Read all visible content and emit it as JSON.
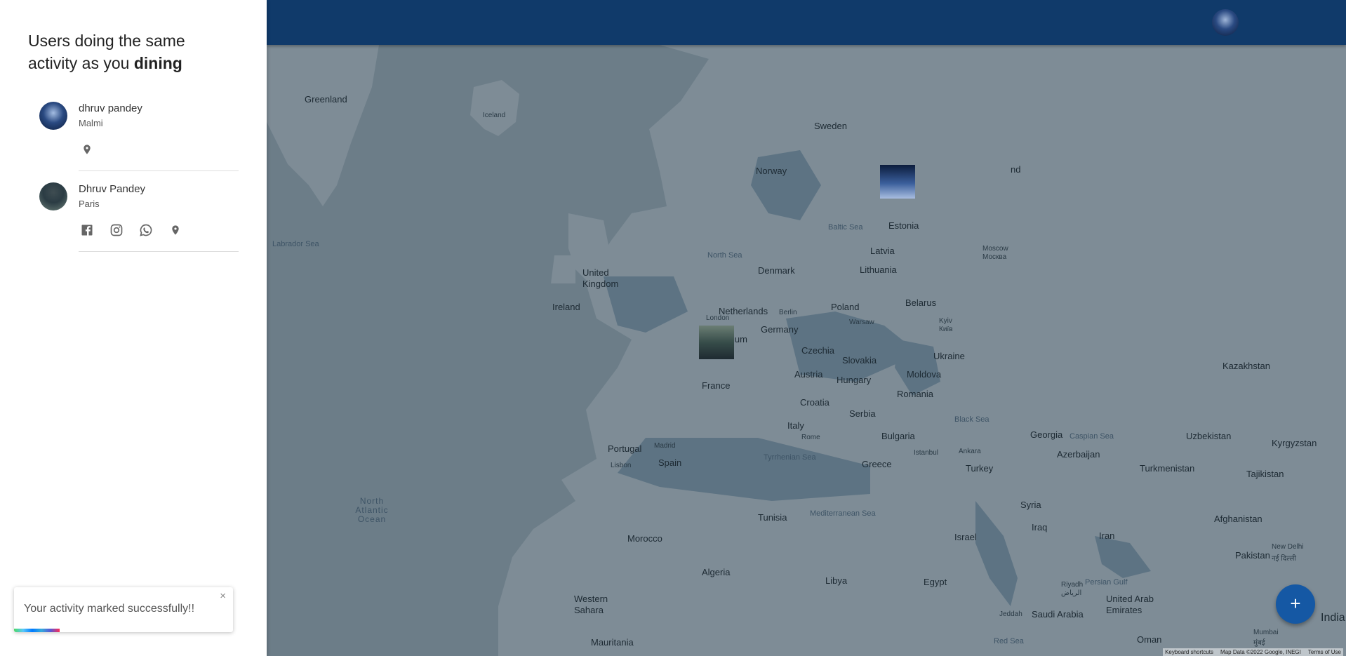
{
  "sidebar": {
    "title_prefix": "Users doing the same activity as you",
    "activity": "dining",
    "users": [
      {
        "name": "dhruv pandey",
        "city": "Malmi",
        "icons": [
          "location-icon"
        ]
      },
      {
        "name": "Dhruv Pandey",
        "city": "Paris",
        "icons": [
          "facebook-icon",
          "instagram-icon",
          "whatsapp-icon",
          "location-icon"
        ]
      }
    ]
  },
  "toast": {
    "message": "Your activity marked successfully!!",
    "close": "×"
  },
  "map": {
    "labels": {
      "greenland": "Greenland",
      "iceland": "Iceland",
      "sweden": "Sweden",
      "norway": "Norway",
      "finland_partial": "nd",
      "estonia": "Estonia",
      "latvia": "Latvia",
      "lithuania": "Lithuania",
      "moscow": "Moscow",
      "moscow_native": "Москва",
      "baltic_sea": "Baltic Sea",
      "labrador_sea": "Labrador Sea",
      "north_sea": "North Sea",
      "united_kingdom": "United Kingdom",
      "denmark": "Denmark",
      "ireland": "Ireland",
      "netherlands": "Netherlands",
      "berlin": "Berlin",
      "poland": "Poland",
      "warsaw": "Warsaw",
      "belarus": "Belarus",
      "london": "London",
      "belgium_partial": "ium",
      "germany": "Germany",
      "kyiv": "Kyiv",
      "kyiv_native": "Київ",
      "czechia": "Czechia",
      "slovakia": "Slovakia",
      "ukraine": "Ukraine",
      "austria": "Austria",
      "hungary": "Hungary",
      "moldova": "Moldova",
      "kazakhstan": "Kazakhstan",
      "france": "France",
      "croatia": "Croatia",
      "romania": "Romania",
      "serbia": "Serbia",
      "black_sea": "Black Sea",
      "italy": "Italy",
      "bulgaria": "Bulgaria",
      "georgia": "Georgia",
      "portugal": "Portugal",
      "madrid": "Madrid",
      "spain": "Spain",
      "rome": "Rome",
      "istanbul": "Istanbul",
      "ankara": "Ankara",
      "caspian_sea": "Caspian Sea",
      "uzbekistan": "Uzbekistan",
      "kyrgyzstan": "Kyrgyzstan",
      "azerbaijan": "Azerbaijan",
      "lisbon": "Lisbon",
      "tyrrhenian_sea": "Tyrrhenian Sea",
      "greece": "Greece",
      "turkey": "Turkey",
      "turkmenistan": "Turkmenistan",
      "tajikistan": "Tajikistan",
      "north_atlantic_ocean": "North Atlantic Ocean",
      "syria": "Syria",
      "tunisia": "Tunisia",
      "mediterranean_sea": "Mediterranean Sea",
      "afghanistan": "Afghanistan",
      "morocco": "Morocco",
      "iraq": "Iraq",
      "iran": "Iran",
      "israel": "Israel",
      "new_delhi": "New Delhi",
      "new_delhi_native": "नई दिल्ली",
      "pakistan": "Pakistan",
      "algeria": "Algeria",
      "libya": "Libya",
      "egypt": "Egypt",
      "persian_gulf": "Persian Gulf",
      "riyadh": "Riyadh",
      "riyadh_native": "الرياض",
      "western_sahara": "Western Sahara",
      "saudi_arabia": "Saudi Arabia",
      "uae": "United Arab Emirates",
      "jeddah": "Jeddah",
      "india": "India",
      "mauritania": "Mauritania",
      "red_sea": "Red Sea",
      "oman": "Oman",
      "mumbai": "Mumbai",
      "mumbai_native": "मुंबई"
    },
    "attribution": {
      "shortcuts": "Keyboard shortcuts",
      "data": "Map Data ©2022 Google, INEGI",
      "terms": "Terms of Use"
    },
    "fab_label": "+"
  }
}
